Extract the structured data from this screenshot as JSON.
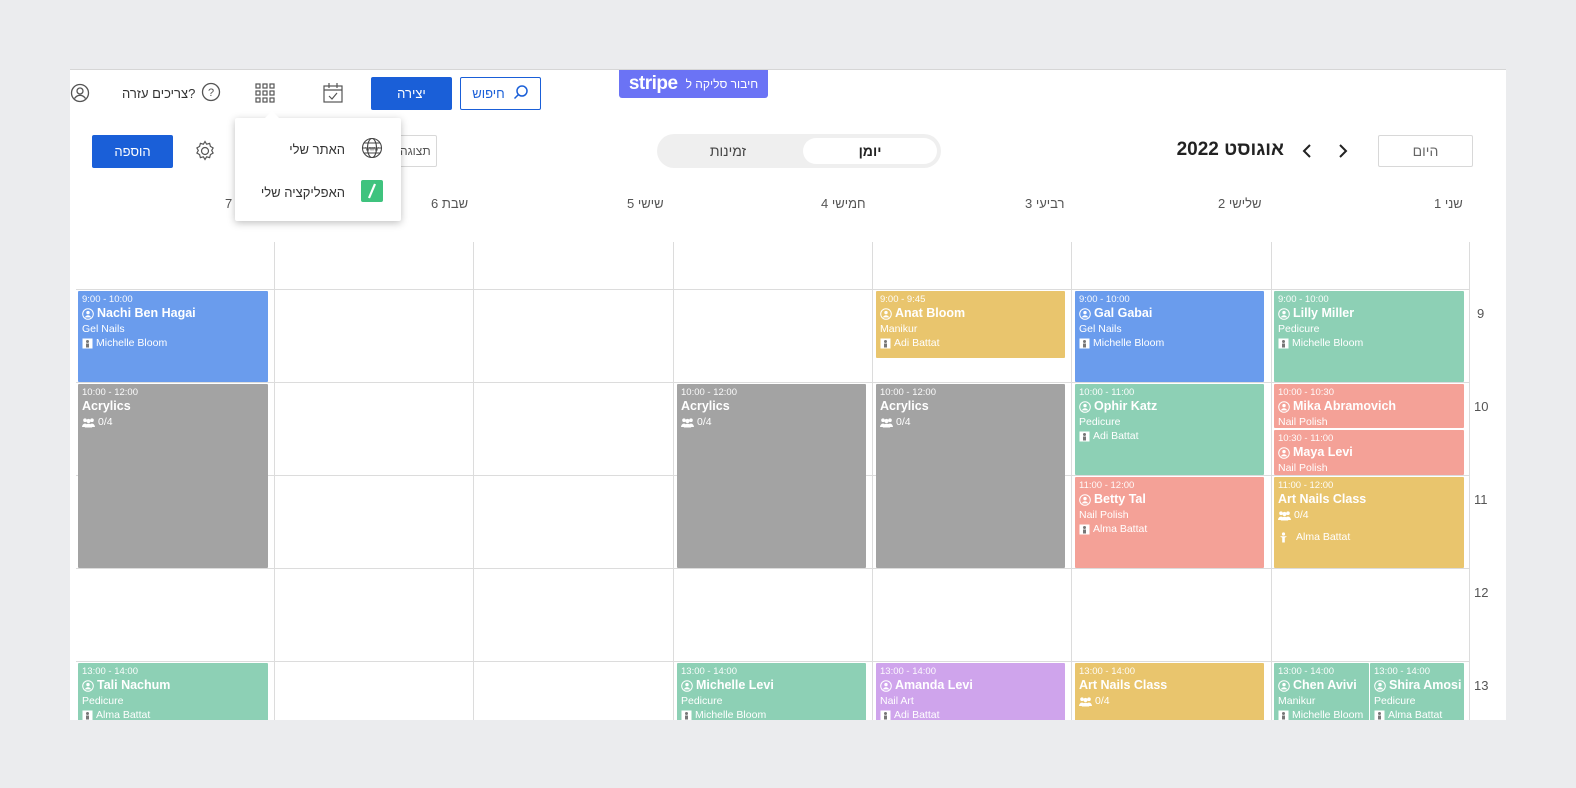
{
  "topbar": {
    "create_label": "יצירה",
    "search_label": "חיפוש",
    "stripe_text": "חיבור סליקה ל",
    "stripe_logo": "stripe",
    "help_label": "צריכים עזרה?"
  },
  "menu": {
    "items": [
      {
        "label": "האתר שלי",
        "icon": "globe-icon"
      },
      {
        "label": "האפליקציה שלי",
        "icon": "app-icon"
      }
    ]
  },
  "header": {
    "today_label": "היום",
    "month": "אוגוסט 2022",
    "view_day": "יומן",
    "view_availability": "זמינות",
    "view_btn_label": "תצוגה",
    "add_label": "הוספה"
  },
  "days": [
    "שני 1",
    "שלישי 2",
    "רביעי 3",
    "חמישי 4",
    "שישי 5",
    "שבת 6",
    "7"
  ],
  "hours": [
    "9",
    "10",
    "11",
    "12",
    "13"
  ],
  "events": [
    {
      "time": "9:00 - 10:00",
      "name": "Lilly Miller",
      "service": "Pedicure",
      "staff": "Michelle Bloom"
    },
    {
      "time": "10:00 - 10:30",
      "name": "Mika Abramovich",
      "service": "Nail Polish"
    },
    {
      "time": "10:30 - 11:00",
      "name": "Maya Levi",
      "service": "Nail Polish"
    },
    {
      "time": "11:00 - 12:00",
      "name": "Art Nails Class",
      "count": "0/4",
      "staff": "Alma Battat"
    },
    {
      "time": "13:00 - 14:00",
      "name": "Chen Avivi",
      "service": "Manikur",
      "staff": "Michelle Bloom"
    },
    {
      "time": "13:00 - 14:00",
      "name": "Shira Amosi",
      "service": "Pedicure",
      "staff": "Alma Battat"
    },
    {
      "time": "9:00 - 10:00",
      "name": "Gal Gabai",
      "service": "Gel Nails",
      "staff": "Michelle Bloom"
    },
    {
      "time": "10:00 - 11:00",
      "name": "Ophir Katz",
      "service": "Pedicure",
      "staff": "Adi Battat"
    },
    {
      "time": "11:00 - 12:00",
      "name": "Betty Tal",
      "service": "Nail Polish",
      "staff": "Alma Battat"
    },
    {
      "time": "13:00 - 14:00",
      "name": "Art Nails Class",
      "count": "0/4"
    },
    {
      "time": "9:00 - 9:45",
      "name": "Anat Bloom",
      "service": "Manikur",
      "staff": "Adi Battat"
    },
    {
      "time": "10:00 - 12:00",
      "name": "Acrylics",
      "count": "0/4"
    },
    {
      "time": "13:00 - 14:00",
      "name": "Amanda Levi",
      "service": "Nail Art",
      "staff": "Adi Battat"
    },
    {
      "time": "10:00 - 12:00",
      "name": "Acrylics",
      "count": "0/4"
    },
    {
      "time": "13:00 - 14:00",
      "name": "Michelle Levi",
      "service": "Pedicure",
      "staff": "Michelle Bloom"
    },
    {
      "time": "9:00 - 10:00",
      "name": "Nachi Ben Hagai",
      "service": "Gel Nails",
      "staff": "Michelle Bloom"
    },
    {
      "time": "10:00 - 12:00",
      "name": "Acrylics",
      "count": "0/4"
    },
    {
      "time": "13:00 - 14:00",
      "name": "Tali Nachum",
      "service": "Pedicure",
      "staff": "Alma Battat"
    }
  ],
  "colors": {
    "primary": "#1a5fd8",
    "green": "#8dd0b5",
    "blue": "#6a9ced",
    "yellow": "#e9c56d",
    "salmon": "#f4a197",
    "gray": "#a3a3a3",
    "purple": "#cfa4ec",
    "stripe": "#6b73f5"
  }
}
